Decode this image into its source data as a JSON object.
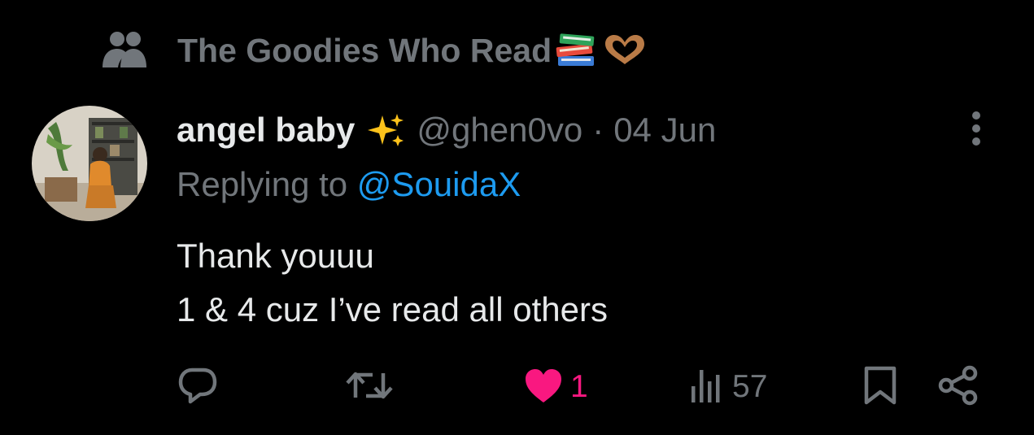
{
  "community": {
    "name": "The Goodies Who Read",
    "name_emoji": [
      "books-emoji",
      "heart-hands-emoji"
    ]
  },
  "tweet": {
    "author": {
      "display_name": "angel baby",
      "name_emoji": "sparkles-emoji",
      "handle": "@ghen0vo"
    },
    "separator": "·",
    "timestamp": "04 Jun",
    "reply_prefix": "Replying to",
    "reply_to": "@SouidaX",
    "text_lines": [
      "Thank youuu",
      "1 & 4 cuz I’ve read all others"
    ]
  },
  "actions": {
    "reply": {
      "icon": "reply-icon"
    },
    "retweet": {
      "icon": "retweet-icon"
    },
    "like": {
      "icon": "heart-filled-icon",
      "count": "1",
      "active": true
    },
    "views": {
      "icon": "views-icon",
      "count": "57"
    },
    "bookmark": {
      "icon": "bookmark-icon"
    },
    "share": {
      "icon": "share-icon"
    }
  },
  "colors": {
    "background": "#000000",
    "primary_text": "#e7e9ea",
    "secondary_text": "#71767b",
    "link": "#1d9bf0",
    "like_active": "#f91880"
  }
}
